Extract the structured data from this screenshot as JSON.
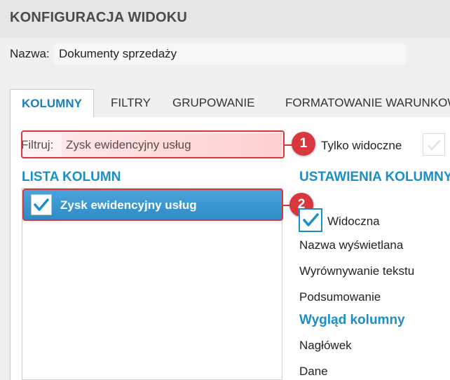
{
  "window": {
    "title": "KONFIGURACJA WIDOKU"
  },
  "name": {
    "label": "Nazwa:",
    "value": "Dokumenty sprzedaży"
  },
  "tabs": [
    {
      "label": "KOLUMNY",
      "active": true
    },
    {
      "label": "FILTRY"
    },
    {
      "label": "GRUPOWANIE"
    },
    {
      "label": "FORMATOWANIE WARUNKOWE"
    }
  ],
  "filter": {
    "label": "Filtruj:",
    "value": "Zysk ewidencyjny usług"
  },
  "only_visible": {
    "label": "Tylko widoczne",
    "checked": false
  },
  "columns_list": {
    "heading": "LISTA KOLUMN",
    "items": [
      {
        "label": "Zysk ewidencyjny usług",
        "checked": true,
        "selected": true
      }
    ]
  },
  "column_settings": {
    "heading": "USTAWIENIA KOLUMNY",
    "visible_label": "Widoczna",
    "visible_checked": true,
    "display_name_label": "Nazwa wyświetlana",
    "text_align_label": "Wyrównywanie tekstu",
    "summary_label": "Podsumowanie",
    "appearance_heading": "Wygląd kolumny",
    "header_label": "Nagłówek",
    "data_label": "Dane"
  },
  "annotations": {
    "badge1": "1",
    "badge2": "2"
  },
  "colors": {
    "accent": "#1a8fc7",
    "highlight": "#d9363e",
    "selection": "#3a97d0"
  }
}
